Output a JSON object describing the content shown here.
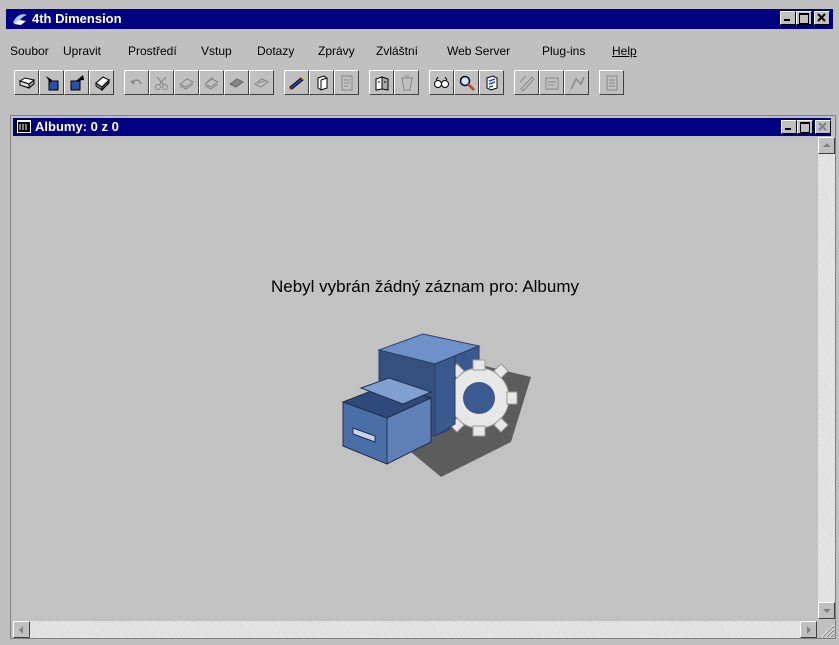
{
  "app": {
    "title": "4th Dimension",
    "window_buttons": {
      "minimize": "_",
      "maximize": "□",
      "close": "×"
    }
  },
  "menu": [
    "Soubor",
    "Upravit",
    "Prostředí",
    "Vstup",
    "Dotazy",
    "Zprávy",
    "Zvláštní",
    "Web Server",
    "Plug-ins",
    "Help"
  ],
  "toolbar": {
    "buttons": [
      "open-file-icon",
      "open-db-icon",
      "import-icon",
      "print-icon",
      "undo-icon",
      "cut-icon",
      "copy-icon",
      "paste-icon",
      "clear-icon",
      "select-all-icon",
      "edit-form-icon",
      "new-record-icon",
      "form-icon",
      "records-icon",
      "delete-record-icon",
      "search-icon",
      "find-icon",
      "sort-icon",
      "report-icon",
      "label-icon",
      "graph-icon",
      "export-icon"
    ]
  },
  "subwindow": {
    "title": "Albumy: 0 z 0",
    "message": "Nebyl vybrán žádný záznam pro: Albumy",
    "illustration": "empty-drawer-icon"
  },
  "colors": {
    "titlebar": "#000080",
    "chrome": "#c0c0c0",
    "drawer": "#4a6fa8"
  }
}
